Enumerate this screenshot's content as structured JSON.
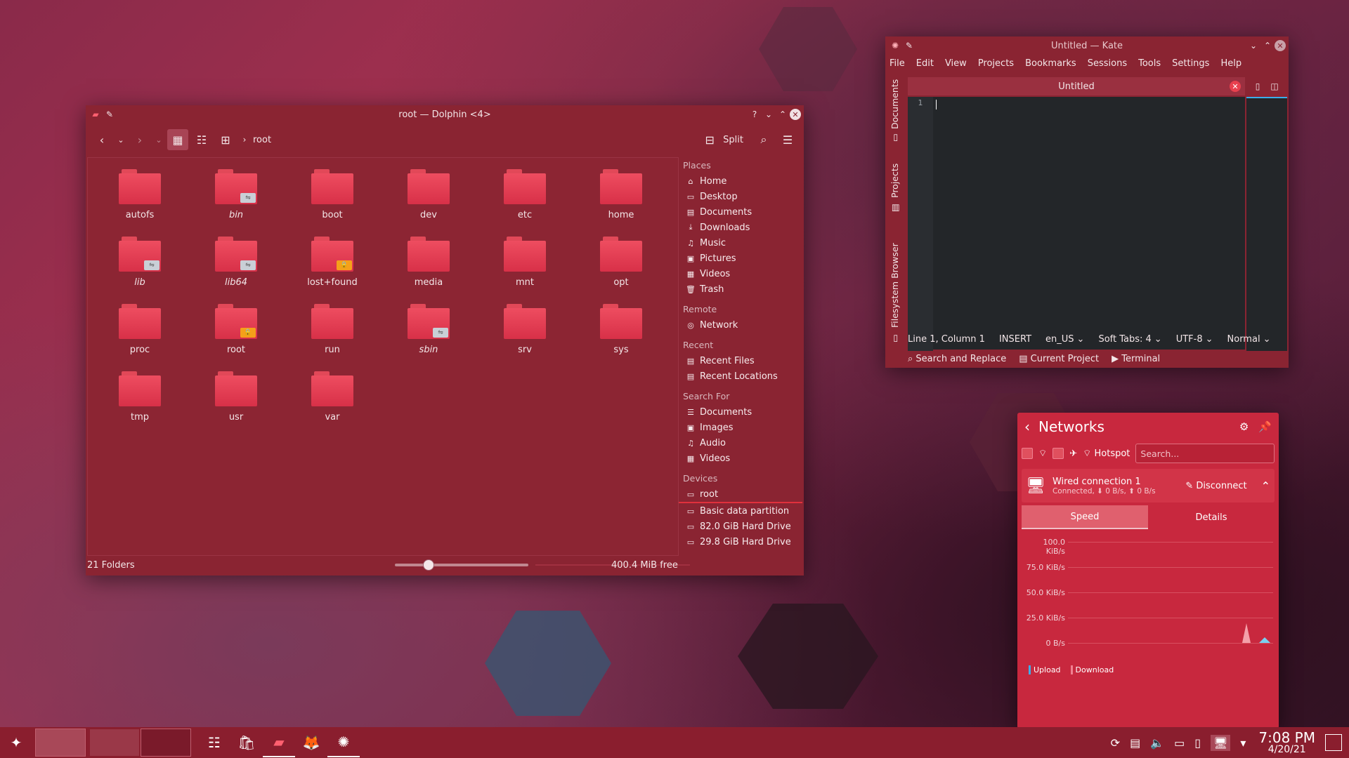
{
  "dolphin": {
    "title": "root — Dolphin <4>",
    "breadcrumb": "root",
    "split_label": "Split",
    "folders": [
      {
        "name": "autofs",
        "italic": false,
        "emblem": ""
      },
      {
        "name": "bin",
        "italic": true,
        "emblem": "link"
      },
      {
        "name": "boot",
        "italic": false,
        "emblem": ""
      },
      {
        "name": "dev",
        "italic": false,
        "emblem": ""
      },
      {
        "name": "etc",
        "italic": false,
        "emblem": ""
      },
      {
        "name": "home",
        "italic": false,
        "emblem": ""
      },
      {
        "name": "lib",
        "italic": true,
        "emblem": "link"
      },
      {
        "name": "lib64",
        "italic": true,
        "emblem": "link"
      },
      {
        "name": "lost+found",
        "italic": false,
        "emblem": "lock"
      },
      {
        "name": "media",
        "italic": false,
        "emblem": ""
      },
      {
        "name": "mnt",
        "italic": false,
        "emblem": ""
      },
      {
        "name": "opt",
        "italic": false,
        "emblem": ""
      },
      {
        "name": "proc",
        "italic": false,
        "emblem": ""
      },
      {
        "name": "root",
        "italic": false,
        "emblem": "lock"
      },
      {
        "name": "run",
        "italic": false,
        "emblem": ""
      },
      {
        "name": "sbin",
        "italic": true,
        "emblem": "link"
      },
      {
        "name": "srv",
        "italic": false,
        "emblem": ""
      },
      {
        "name": "sys",
        "italic": false,
        "emblem": ""
      },
      {
        "name": "tmp",
        "italic": false,
        "emblem": ""
      },
      {
        "name": "usr",
        "italic": false,
        "emblem": ""
      },
      {
        "name": "var",
        "italic": false,
        "emblem": ""
      }
    ],
    "places": [
      {
        "section": "Places",
        "items": [
          {
            "label": "Home",
            "icon": "home-icon",
            "glyph": "⌂"
          },
          {
            "label": "Desktop",
            "icon": "desktop-icon",
            "glyph": "▭"
          },
          {
            "label": "Documents",
            "icon": "documents-icon",
            "glyph": "▤"
          },
          {
            "label": "Downloads",
            "icon": "downloads-icon",
            "glyph": "⤓"
          },
          {
            "label": "Music",
            "icon": "music-icon",
            "glyph": "♫"
          },
          {
            "label": "Pictures",
            "icon": "pictures-icon",
            "glyph": "▣"
          },
          {
            "label": "Videos",
            "icon": "videos-icon",
            "glyph": "▦"
          },
          {
            "label": "Trash",
            "icon": "trash-icon",
            "glyph": "🗑"
          }
        ]
      },
      {
        "section": "Remote",
        "items": [
          {
            "label": "Network",
            "icon": "network-icon",
            "glyph": "◎"
          }
        ]
      },
      {
        "section": "Recent",
        "items": [
          {
            "label": "Recent Files",
            "icon": "recent-files-icon",
            "glyph": "▤"
          },
          {
            "label": "Recent Locations",
            "icon": "recent-locations-icon",
            "glyph": "▤"
          }
        ]
      },
      {
        "section": "Search For",
        "items": [
          {
            "label": "Documents",
            "icon": "search-documents-icon",
            "glyph": "☰"
          },
          {
            "label": "Images",
            "icon": "search-images-icon",
            "glyph": "▣"
          },
          {
            "label": "Audio",
            "icon": "search-audio-icon",
            "glyph": "♫"
          },
          {
            "label": "Videos",
            "icon": "search-videos-icon",
            "glyph": "▦"
          }
        ]
      },
      {
        "section": "Devices",
        "items": [
          {
            "label": "root",
            "icon": "drive-icon",
            "glyph": "▭",
            "selected": true
          },
          {
            "label": "Basic data partition",
            "icon": "drive-icon",
            "glyph": "▭"
          },
          {
            "label": "82.0 GiB Hard Drive",
            "icon": "drive-icon",
            "glyph": "▭"
          },
          {
            "label": "29.8 GiB Hard Drive",
            "icon": "drive-icon",
            "glyph": "▭"
          }
        ]
      }
    ],
    "status_left": "21 Folders",
    "free_space": "400.4 MiB free"
  },
  "kate": {
    "title": "Untitled — Kate",
    "menu": [
      "File",
      "Edit",
      "View",
      "Projects",
      "Bookmarks",
      "Sessions",
      "Tools",
      "Settings",
      "Help"
    ],
    "tab": "Untitled",
    "line_number": "1",
    "side_tabs": [
      "Documents",
      "Projects",
      "Filesystem Browser"
    ],
    "status": [
      "Line 1, Column 1",
      "INSERT",
      "en_US",
      "Soft Tabs: 4",
      "UTF-8",
      "Normal"
    ],
    "bottom": [
      "Search and Replace",
      "Current Project",
      "Terminal"
    ]
  },
  "networks": {
    "title": "Networks",
    "hotspot": "Hotspot",
    "search_placeholder": "Search...",
    "connection_name": "Wired connection 1",
    "connection_status": "Connected, ⬇ 0 B/s, ⬆ 0 B/s",
    "disconnect": "Disconnect",
    "tabs": [
      "Speed",
      "Details"
    ],
    "graph_labels": [
      "100.0 KiB/s",
      "75.0 KiB/s",
      "50.0 KiB/s",
      "25.0 KiB/s",
      "0 B/s"
    ],
    "legend": [
      "Upload",
      "Download"
    ]
  },
  "taskbar": {
    "time": "7:08 PM",
    "date": "4/20/21"
  }
}
